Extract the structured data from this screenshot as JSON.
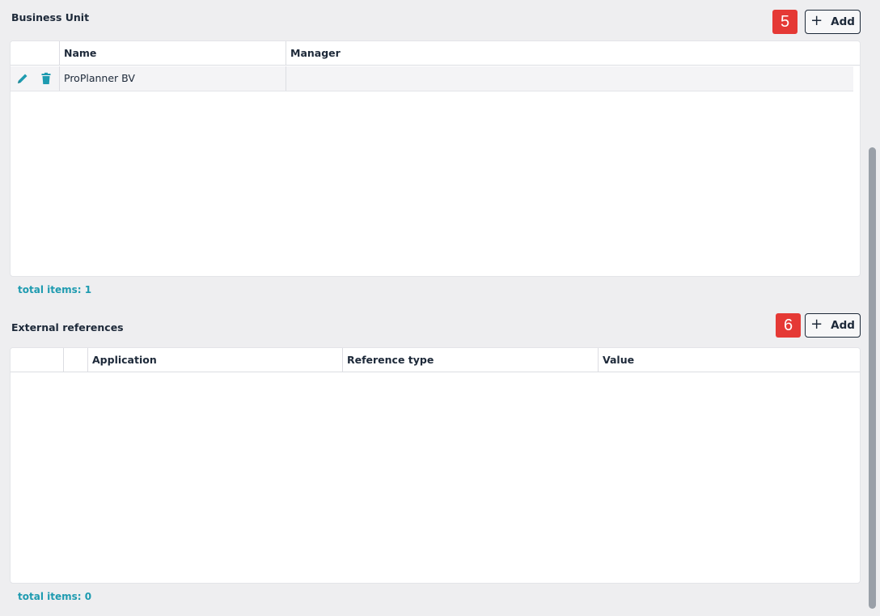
{
  "business_unit": {
    "title": "Business Unit",
    "badge": "5",
    "add_label": "Add",
    "columns": [
      "Name",
      "Manager"
    ],
    "rows": [
      {
        "name": "ProPlanner BV",
        "manager": ""
      }
    ],
    "total": "total items: 1"
  },
  "external_references": {
    "title": "External references",
    "badge": "6",
    "add_label": "Add",
    "columns": [
      "Application",
      "Reference type",
      "Value"
    ],
    "total": "total items: 0"
  },
  "colors": {
    "accent": "#1e9bb0",
    "badge": "#e53935",
    "text": "#1d2939"
  },
  "icons": {
    "edit": "pencil-icon",
    "delete": "trash-icon",
    "add": "plus-icon"
  }
}
